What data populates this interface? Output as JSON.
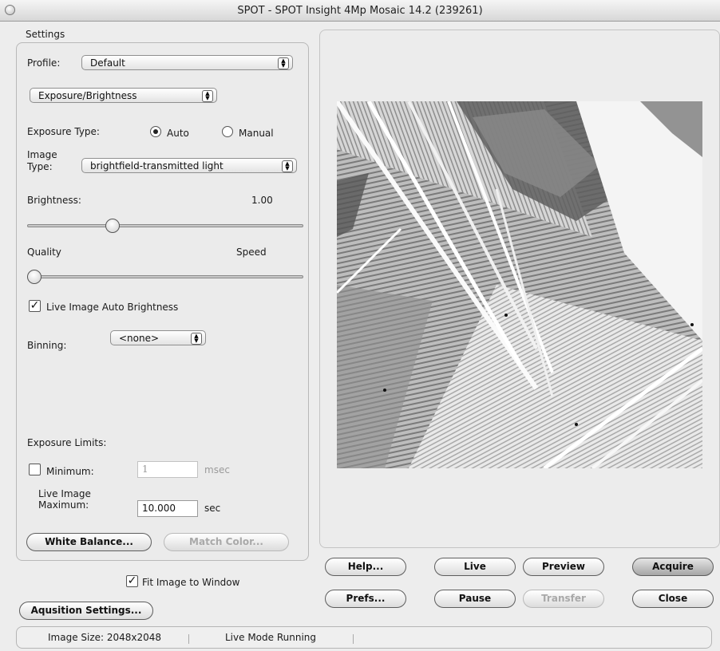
{
  "window": {
    "title": "SPOT - SPOT Insight 4Mp Mosaic 14.2 (239261)"
  },
  "settings": {
    "group_title": "Settings",
    "profile_label": "Profile:",
    "profile_value": "Default",
    "section_value": "Exposure/Brightness",
    "exposure_type_label": "Exposure Type:",
    "exposure_auto": "Auto",
    "exposure_manual": "Manual",
    "exposure_selected": "Auto",
    "image_type_label_1": "Image",
    "image_type_label_2": "Type:",
    "image_type_value": "brightfield-transmitted light",
    "brightness_label": "Brightness:",
    "brightness_value": "1.00",
    "brightness_slider_fraction": 0.3,
    "quality_label": "Quality",
    "speed_label": "Speed",
    "quality_slider_fraction": 0.0,
    "live_auto_brightness_label": "Live Image Auto Brightness",
    "live_auto_brightness_checked": true,
    "binning_label": "Binning:",
    "binning_value": "<none>",
    "exposure_limits_label": "Exposure Limits:",
    "minimum_label": "Minimum:",
    "minimum_checked": false,
    "minimum_value": "1",
    "minimum_unit": "msec",
    "live_max_label_1": "Live Image",
    "live_max_label_2": "Maximum:",
    "live_max_value": "10.000",
    "live_max_unit": "sec",
    "white_balance_button": "White Balance...",
    "match_color_button": "Match Color..."
  },
  "fit_image_label": "Fit Image to Window",
  "fit_image_checked": true,
  "acquisition_button": "Aqusition Settings...",
  "buttons": {
    "help": "Help...",
    "live": "Live",
    "preview": "Preview",
    "acquire": "Acquire",
    "prefs": "Prefs...",
    "pause": "Pause",
    "transfer": "Transfer",
    "close": "Close"
  },
  "status": {
    "image_size": "Image Size: 2048x2048",
    "mode": "Live Mode Running"
  }
}
